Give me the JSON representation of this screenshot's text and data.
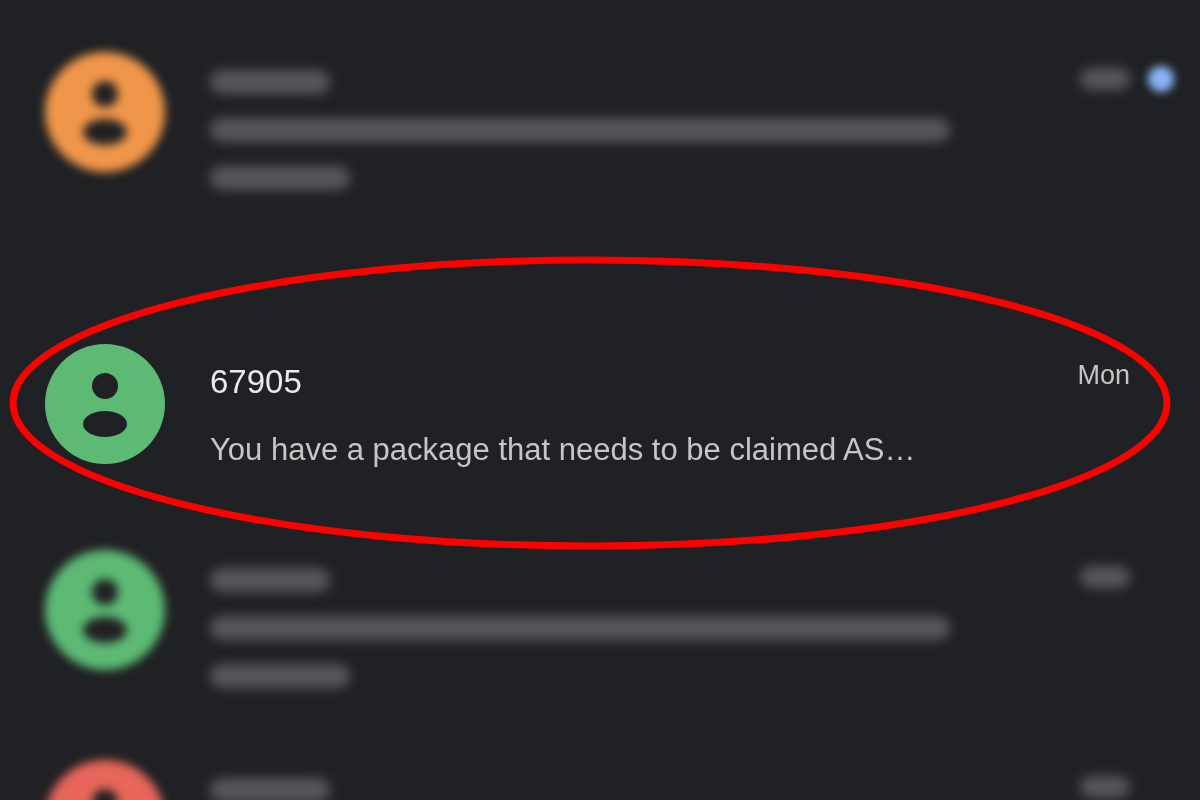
{
  "conversations": [
    {
      "kind": "blurred",
      "color": "#f0964a",
      "unread": true
    },
    {
      "kind": "clear",
      "color": "#5dba74",
      "unread": false,
      "sender": "67905",
      "preview": "You have a package that needs to be claimed AS…",
      "time": "Mon"
    },
    {
      "kind": "blurred",
      "color": "#5dba74",
      "unread": false
    },
    {
      "kind": "blurred",
      "color": "#e8665a",
      "unread": false
    }
  ],
  "highlight": {
    "kind": "ellipse",
    "color": "#ff0000"
  }
}
